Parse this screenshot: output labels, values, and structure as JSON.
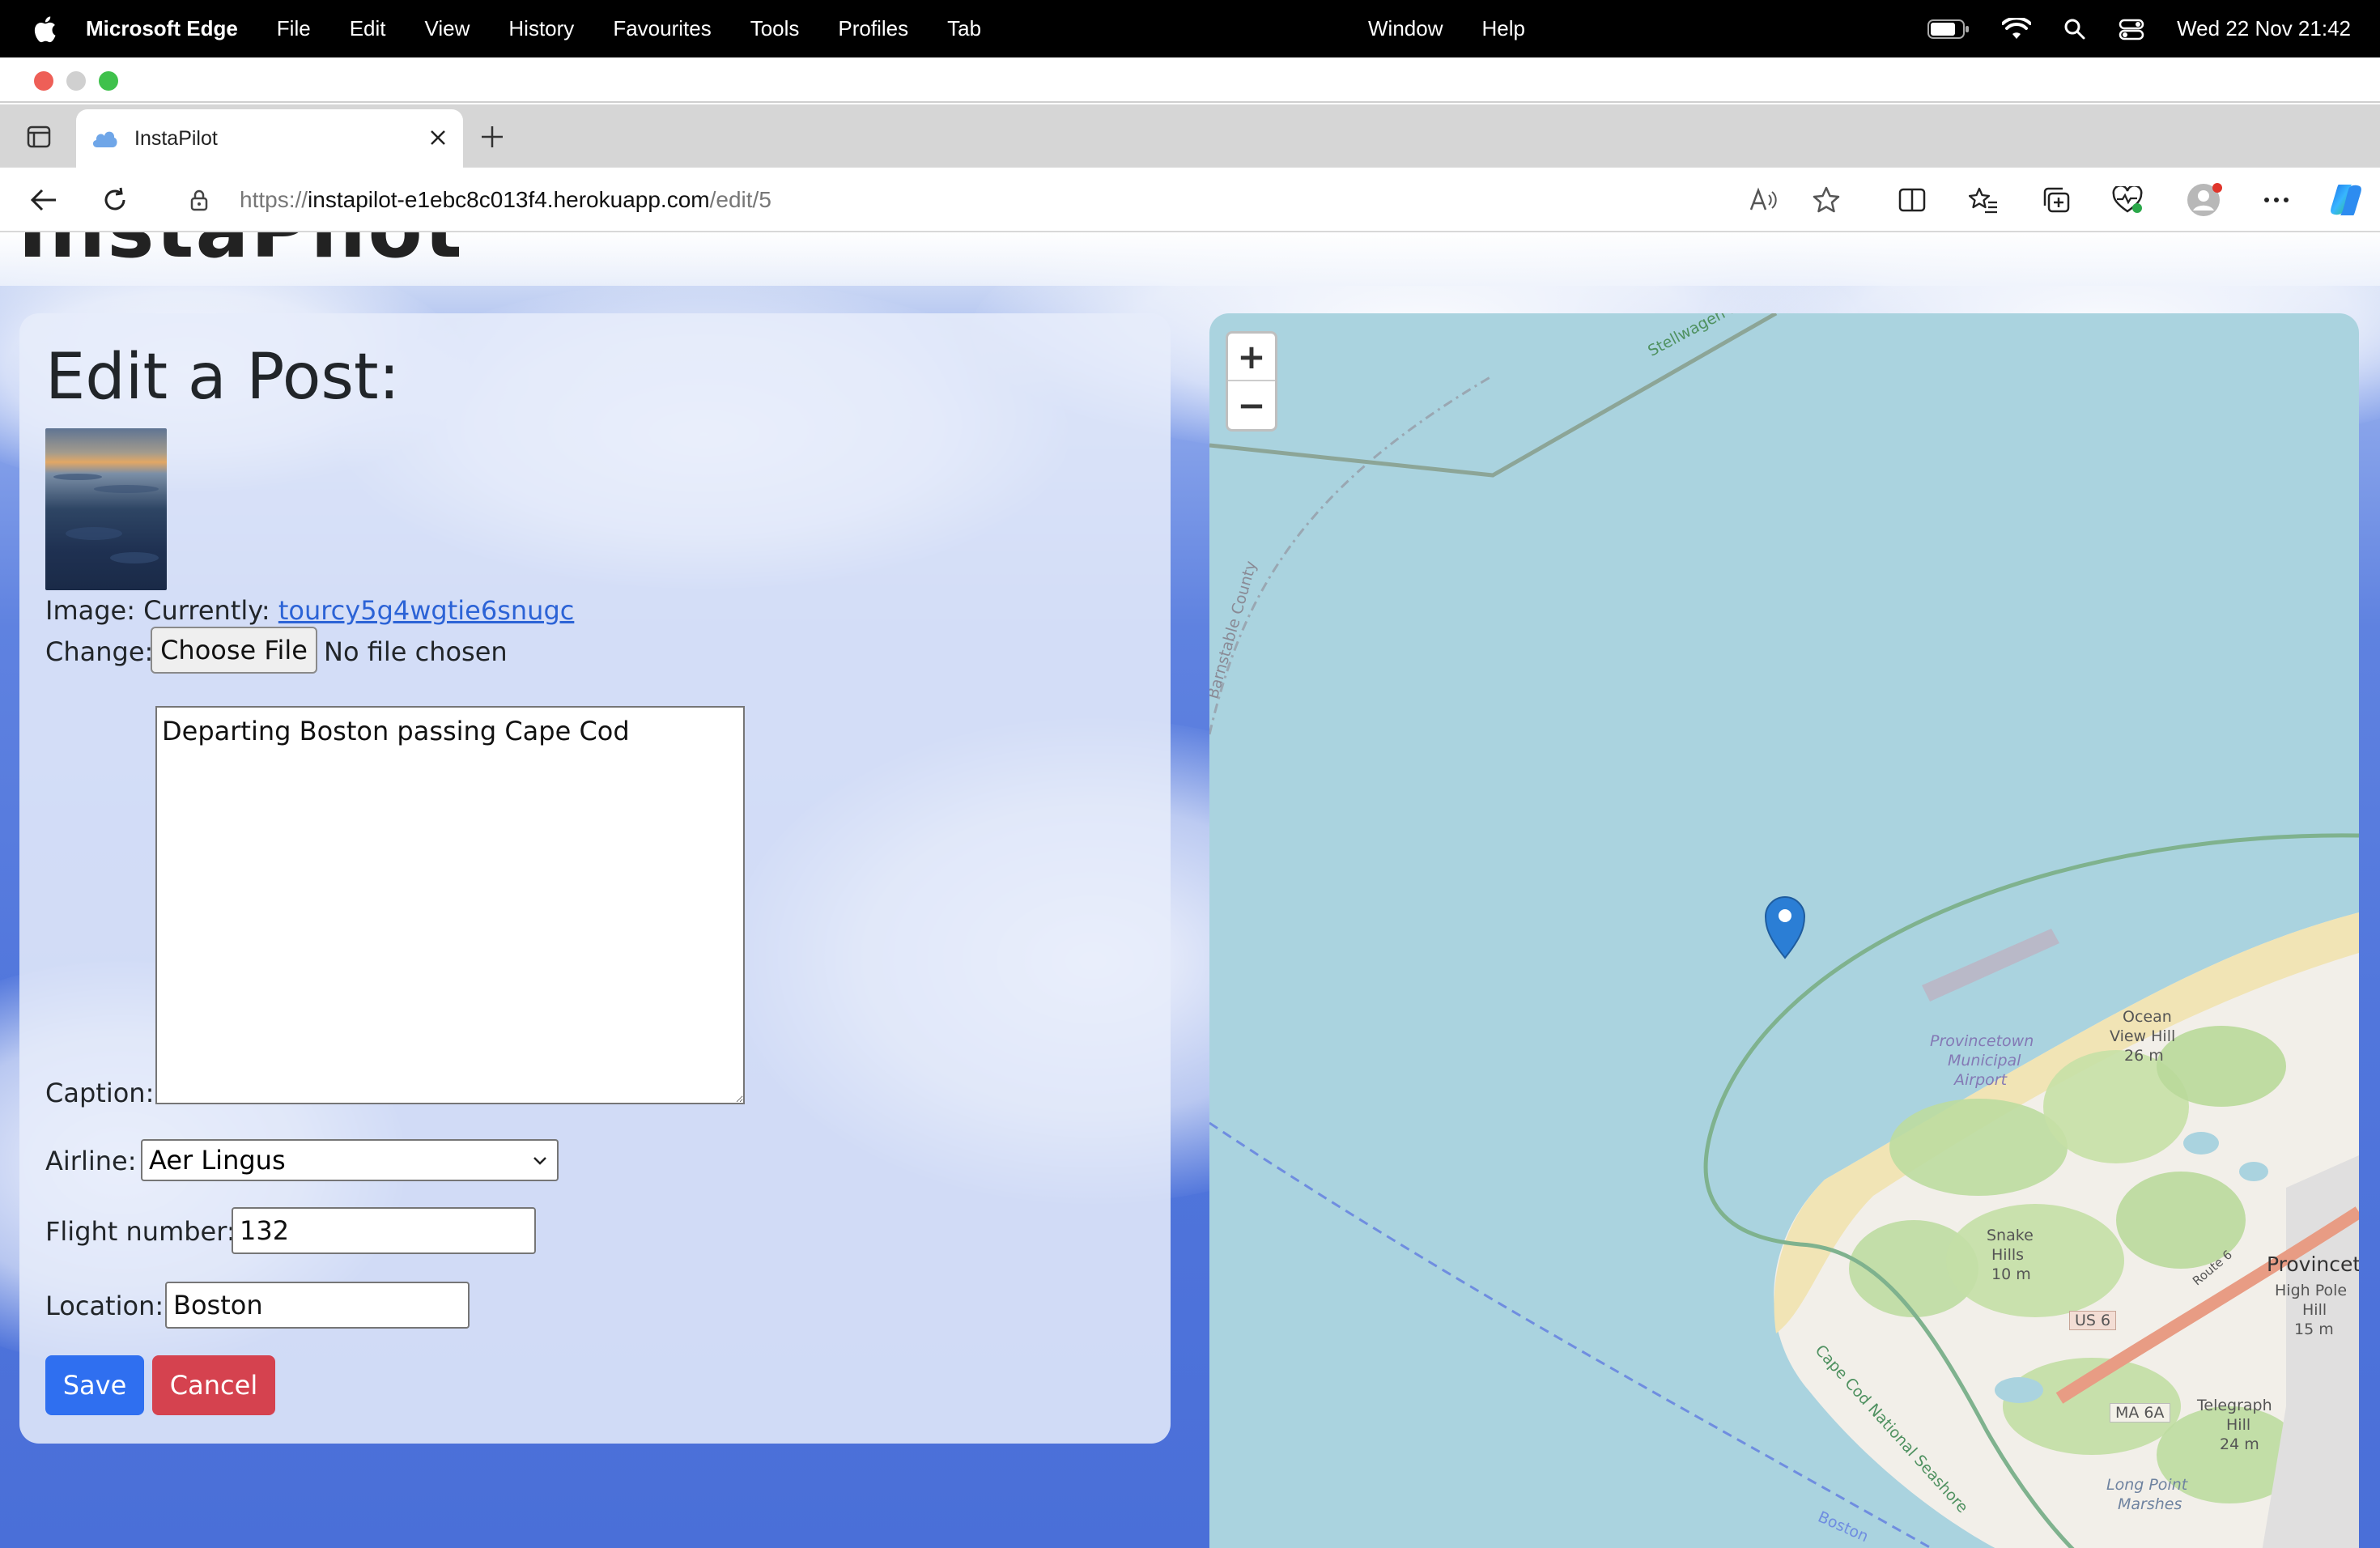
{
  "menubar": {
    "app_name": "Microsoft Edge",
    "items": [
      "File",
      "Edit",
      "View",
      "History",
      "Favourites",
      "Tools",
      "Profiles",
      "Tab"
    ],
    "center_items": [
      "Window",
      "Help"
    ],
    "clock": "Wed 22 Nov  21:42"
  },
  "browser": {
    "tab_title": "InstaPilot",
    "url_scheme": "https://",
    "url_host": "instapilot-e1ebc8c013f4.herokuapp.com",
    "url_path": "/edit/5"
  },
  "page": {
    "site_title": "InstaPilot",
    "heading": "Edit a Post:",
    "image_label": "Image: Currently:",
    "image_link": "tourcy5g4wgtie6snugc",
    "change_label": "Change:",
    "choose_file_label": "Choose File",
    "no_file_text": "No file chosen",
    "caption_label": "Caption:",
    "caption_value": "Departing Boston passing Cape Cod",
    "airline_label": "Airline:",
    "airline_value": "Aer Lingus",
    "flight_label": "Flight number:",
    "flight_value": "132",
    "location_label": "Location:",
    "location_value": "Boston",
    "save_label": "Save",
    "cancel_label": "Cancel"
  },
  "map": {
    "zoom_in": "+",
    "zoom_out": "−",
    "labels": {
      "stellwagen": "Stellwagen B",
      "barnstable": "Barnstable County",
      "ocean_view": "Ocean",
      "ocean_view2": "View Hill",
      "ocean_view_h": "26 m",
      "airport1": "Provincetown",
      "airport2": "Municipal",
      "airport3": "Airport",
      "snake1": "Snake",
      "snake2": "Hills",
      "snake_h": "10 m",
      "provincetown": "Provincet",
      "highpole1": "High Pole",
      "highpole2": "Hill",
      "highpole_h": "15 m",
      "seashore": "Cape Cod National Seashore",
      "us6": "US 6",
      "route6": "Route 6",
      "ma6a": "MA 6A",
      "telegraph1": "Telegraph",
      "telegraph2": "Hill",
      "telegraph_h": "24 m",
      "longpoint1": "Long Point",
      "longpoint2": "Marshes",
      "boston": "Boston"
    }
  }
}
